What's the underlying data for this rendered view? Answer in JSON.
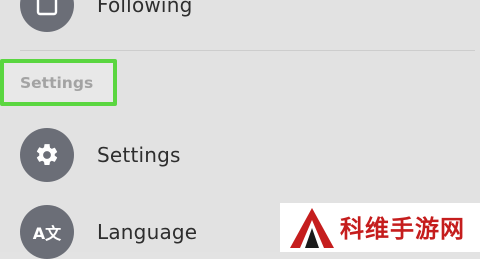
{
  "menu": {
    "following": {
      "label": "Following",
      "icon": "square-outline-icon"
    },
    "section_header": "Settings",
    "settings": {
      "label": "Settings",
      "icon": "gear-icon"
    },
    "language": {
      "label": "Language",
      "icon": "translate-icon",
      "icon_text": "A文"
    }
  },
  "watermark": {
    "text": "科维手游网",
    "accent_color": "#c51d1d"
  },
  "colors": {
    "background": "#e2e2e2",
    "icon_circle": "#6b6e77",
    "highlight_border": "#5ad640"
  }
}
